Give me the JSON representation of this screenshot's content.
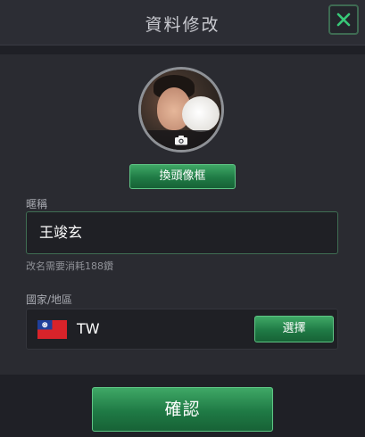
{
  "header": {
    "title": "資料修改",
    "close_icon": "close-icon"
  },
  "avatar": {
    "camera_icon": "camera-icon"
  },
  "buttons": {
    "change_frame": "換頭像框",
    "select": "選擇",
    "confirm": "確認"
  },
  "nickname": {
    "label": "暱稱",
    "value": "王竣玄",
    "hint": "改名需要消耗188鑽"
  },
  "country": {
    "label": "國家/地區",
    "code": "TW",
    "flag_icon": "taiwan-flag-icon"
  },
  "colors": {
    "accent_green": "#1f7a45",
    "close_x": "#38c878"
  }
}
